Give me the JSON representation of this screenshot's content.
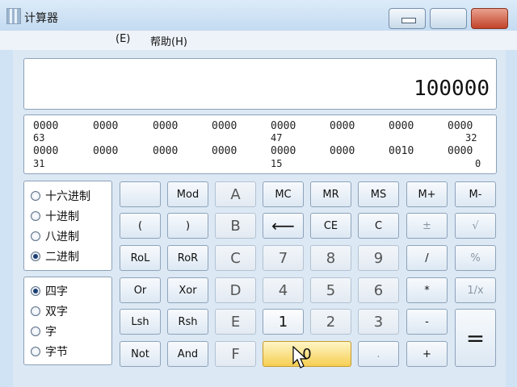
{
  "window": {
    "title": "计算器"
  },
  "menu": {
    "items": [
      "(E)",
      "帮助(H)"
    ]
  },
  "display": {
    "value": "100000"
  },
  "bits": {
    "row1": {
      "groups": [
        "0000",
        "0000",
        "0000",
        "0000",
        "0000",
        "0000",
        "0000",
        "0000"
      ],
      "labels": [
        "63",
        "47",
        "32"
      ]
    },
    "row2": {
      "groups": [
        "0000",
        "0000",
        "0000",
        "0000",
        "0000",
        "0000",
        "0010",
        "0000"
      ],
      "labels": [
        "31",
        "15",
        "0"
      ]
    }
  },
  "base": {
    "options": [
      "十六进制",
      "十进制",
      "八进制",
      "二进制"
    ],
    "selected": "二进制"
  },
  "word": {
    "options": [
      "四字",
      "双字",
      "字",
      "字节"
    ],
    "selected": "四字"
  },
  "keys": {
    "mod": "Mod",
    "a": "A",
    "mc": "MC",
    "mr": "MR",
    "ms": "MS",
    "mplus": "M+",
    "mminus": "M-",
    "lparen": "(",
    "rparen": ")",
    "b": "B",
    "back": "⟵",
    "ce": "CE",
    "c": "C",
    "plusminus": "±",
    "sqrt": "√",
    "rol": "RoL",
    "ror": "RoR",
    "hc": "C",
    "n7": "7",
    "n8": "8",
    "n9": "9",
    "div": "/",
    "pct": "%",
    "or": "Or",
    "xor": "Xor",
    "d": "D",
    "n4": "4",
    "n5": "5",
    "n6": "6",
    "mul": "*",
    "recip": "1/x",
    "lsh": "Lsh",
    "rsh": "Rsh",
    "e": "E",
    "n1": "1",
    "n2": "2",
    "n3": "3",
    "sub": "-",
    "eq": "=",
    "not": "Not",
    "and": "And",
    "f": "F",
    "n0": "0",
    "dot": ".",
    "add": "+"
  }
}
